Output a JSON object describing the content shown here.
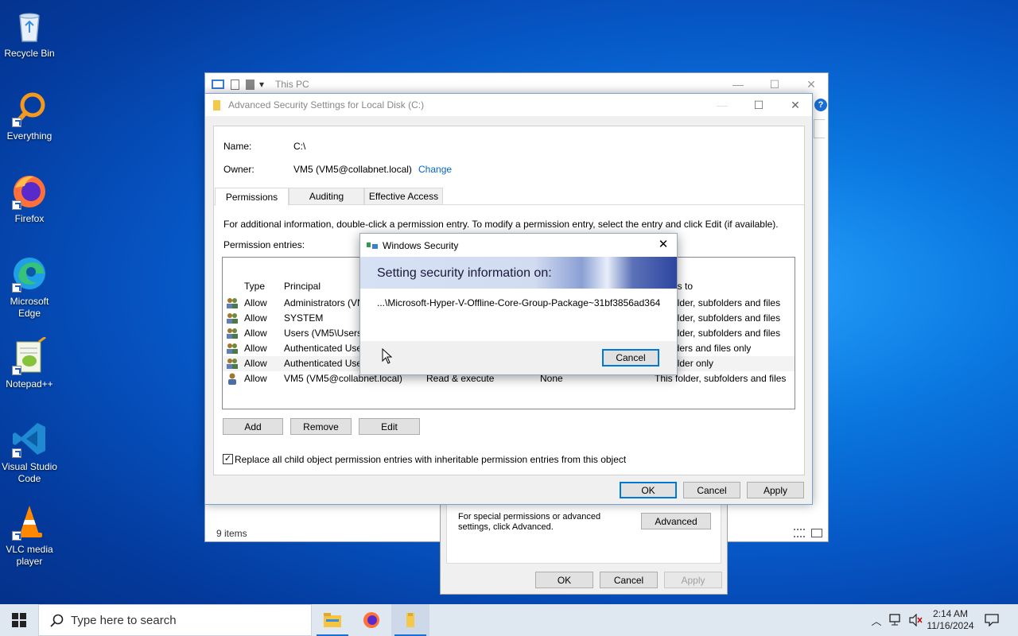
{
  "desktop": {
    "icons": [
      {
        "label": "Recycle Bin"
      },
      {
        "label": "Everything"
      },
      {
        "label": "Firefox"
      },
      {
        "label": "Microsoft Edge"
      },
      {
        "label": "Notepad++"
      },
      {
        "label": "Visual Studio Code"
      },
      {
        "label": "VLC media player"
      }
    ]
  },
  "explorer": {
    "title": "This PC",
    "status": "9 items"
  },
  "properties": {
    "note": "For special permissions or advanced settings, click Advanced.",
    "advanced_label": "Advanced",
    "ok_label": "OK",
    "cancel_label": "Cancel",
    "apply_label": "Apply"
  },
  "advanced_security": {
    "title": "Advanced Security Settings for Local Disk (C:)",
    "name_label": "Name:",
    "name_value": "C:\\",
    "owner_label": "Owner:",
    "owner_value": "VM5 (VM5@collabnet.local)",
    "change_label": "Change",
    "tabs": [
      {
        "label": "Permissions"
      },
      {
        "label": "Auditing"
      },
      {
        "label": "Effective Access"
      }
    ],
    "info": "For additional information, double-click a permission entry. To modify a permission entry, select the entry and click Edit (if available).",
    "entries_label": "Permission entries:",
    "columns": {
      "type": "Type",
      "principal": "Principal",
      "applies": "es to"
    },
    "rows": [
      {
        "type": "Allow",
        "principal": "Administrators (VN",
        "access": "",
        "inherited": "",
        "applies": "older, subfolders and files"
      },
      {
        "type": "Allow",
        "principal": "SYSTEM",
        "access": "",
        "inherited": "",
        "applies": "older, subfolders and files"
      },
      {
        "type": "Allow",
        "principal": "Users (VM5\\Users)",
        "access": "",
        "inherited": "",
        "applies": "older, subfolders and files"
      },
      {
        "type": "Allow",
        "principal": "Authenticated Use",
        "access": "",
        "inherited": "",
        "applies": "lders and files only"
      },
      {
        "type": "Allow",
        "principal": "Authenticated Use",
        "access": "",
        "inherited": "",
        "applies": "older only"
      },
      {
        "type": "Allow",
        "principal": "VM5 (VM5@collabnet.local)",
        "access": "Read & execute",
        "inherited": "None",
        "applies": "This folder, subfolders and files"
      }
    ],
    "add_label": "Add",
    "remove_label": "Remove",
    "edit_label": "Edit",
    "replace_label": "Replace all child object permission entries with inheritable permission entries from this object",
    "replace_checked": true,
    "ok_label": "OK",
    "cancel_label": "Cancel",
    "apply_label": "Apply"
  },
  "security_dialog": {
    "title": "Windows Security",
    "banner": "Setting security information on:",
    "path": "...\\Microsoft-Hyper-V-Offline-Core-Group-Package~31bf3856ad364",
    "cancel_label": "Cancel"
  },
  "taskbar": {
    "search_placeholder": "Type here to search",
    "time": "2:14 AM",
    "date": "11/16/2024"
  }
}
